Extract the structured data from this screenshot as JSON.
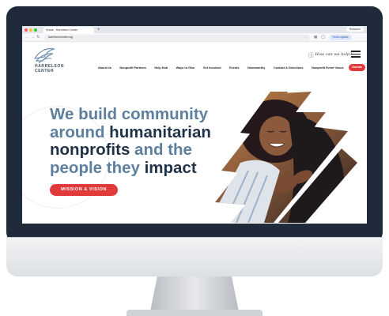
{
  "browser": {
    "tab_title": "Home - Harrelson Center",
    "new_tab": "+",
    "relaunch": "Relaunch",
    "url": "harrelsoncenter.org",
    "update": "Finish update"
  },
  "site": {
    "logo_line1": "HARRELSON",
    "logo_line2": "CENTER",
    "help_text": "How can we help?",
    "nav": [
      "About Us",
      "Nonprofit Partners",
      "Help Hub",
      "Ways to Give",
      "Get Involved",
      "Events",
      "Newsworthy",
      "Contact & Directions",
      "Nonprofit Event Venue"
    ],
    "donate": "Donate"
  },
  "hero": {
    "line1": "We build community",
    "line2a": "around ",
    "line2b": "humanitarian",
    "line3a": "nonprofits ",
    "line3b": "and the",
    "line4a": "people they ",
    "line4b": "impact",
    "cta": "MISSION & VISION"
  },
  "colors": {
    "accent_red": "#e03a3a",
    "headline_slate": "#5e7f9e",
    "headline_navy": "#1f3247",
    "monitor_frame": "#1f2a3a"
  }
}
